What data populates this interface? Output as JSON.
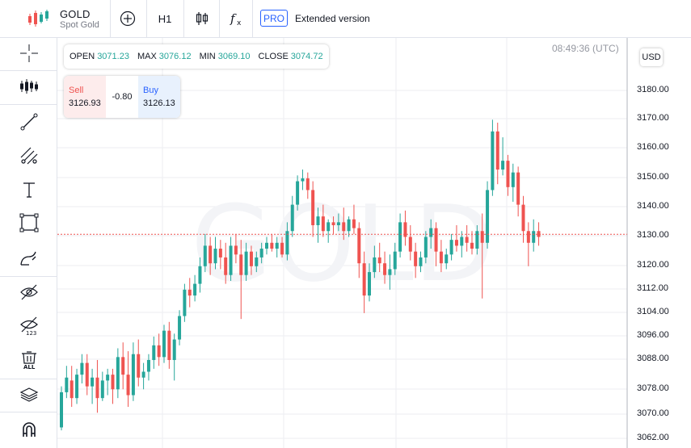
{
  "header": {
    "symbol": "GOLD",
    "subtitle": "Spot Gold",
    "timeframe": "H1",
    "pro_badge": "PRO",
    "extended_label": "Extended version"
  },
  "toolbar_icons": [
    "cursor-crosshair-icon",
    "indicators-icon",
    "trend-line-icon",
    "fib-channel-icon",
    "text-tool-icon",
    "rectangle-tool-icon",
    "brush-icon",
    "hide-drawings-icon",
    "hide-values-icon",
    "delete-all-icon",
    "layers-icon",
    "magnet-icon"
  ],
  "ohlc": {
    "open_label": "OPEN",
    "open": "3071.23",
    "max_label": "MAX",
    "max": "3076.12",
    "min_label": "MIN",
    "min": "3069.10",
    "close_label": "CLOSE",
    "close": "3074.72"
  },
  "trade": {
    "sell_label": "Sell",
    "sell_price": "3126.93",
    "spread": "-0.80",
    "buy_label": "Buy",
    "buy_price": "3126.13"
  },
  "clock": "08:49:36 (UTC)",
  "currency": "USD",
  "watermark": "GOLD",
  "colors": {
    "up": "#26a69a",
    "down": "#ef5350",
    "price_line": "#ef5350",
    "accent": "#2962ff"
  },
  "chart_data": {
    "type": "candlestick",
    "current_price": 3126.9,
    "y_tick_labels": [
      "3180.00",
      "3170.00",
      "3160.00",
      "3150.00",
      "3140.00",
      "3130.00",
      "3120.00",
      "3112.00",
      "3104.00",
      "3096.00",
      "3088.00",
      "3078.00",
      "3070.00",
      "3062.00"
    ],
    "candles": [
      [
        3061,
        3075,
        3060,
        3073
      ],
      [
        3073,
        3082,
        3071,
        3078
      ],
      [
        3077,
        3082,
        3068,
        3071
      ],
      [
        3071,
        3081,
        3069,
        3079
      ],
      [
        3079,
        3086,
        3076,
        3083
      ],
      [
        3083,
        3086,
        3072,
        3075
      ],
      [
        3075,
        3081,
        3069,
        3078
      ],
      [
        3078,
        3084,
        3066,
        3071
      ],
      [
        3071,
        3080,
        3070,
        3077
      ],
      [
        3077,
        3081,
        3072,
        3079
      ],
      [
        3079,
        3081,
        3069,
        3074
      ],
      [
        3074,
        3088,
        3071,
        3085
      ],
      [
        3085,
        3090,
        3074,
        3079
      ],
      [
        3079,
        3087,
        3068,
        3072
      ],
      [
        3072,
        3090,
        3070,
        3086
      ],
      [
        3086,
        3091,
        3075,
        3078
      ],
      [
        3078,
        3083,
        3074,
        3080
      ],
      [
        3080,
        3086,
        3077,
        3084
      ],
      [
        3084,
        3092,
        3081,
        3089
      ],
      [
        3089,
        3093,
        3082,
        3085
      ],
      [
        3085,
        3096,
        3083,
        3094
      ],
      [
        3094,
        3097,
        3081,
        3084
      ],
      [
        3084,
        3093,
        3077,
        3091
      ],
      [
        3091,
        3101,
        3089,
        3099
      ],
      [
        3099,
        3110,
        3097,
        3108
      ],
      [
        3108,
        3112,
        3102,
        3106
      ],
      [
        3106,
        3113,
        3104,
        3110
      ],
      [
        3110,
        3119,
        3107,
        3116
      ],
      [
        3116,
        3127,
        3114,
        3123
      ],
      [
        3123,
        3126,
        3113,
        3117
      ],
      [
        3117,
        3126,
        3115,
        3122
      ],
      [
        3122,
        3125,
        3115,
        3119
      ],
      [
        3119,
        3124,
        3110,
        3113
      ],
      [
        3113,
        3126,
        3111,
        3123
      ],
      [
        3123,
        3127,
        3117,
        3120
      ],
      [
        3120,
        3125,
        3098,
        3113
      ],
      [
        3113,
        3124,
        3111,
        3121
      ],
      [
        3121,
        3123,
        3113,
        3116
      ],
      [
        3116,
        3121,
        3114,
        3119
      ],
      [
        3119,
        3124,
        3117,
        3122
      ],
      [
        3122,
        3126,
        3120,
        3124
      ],
      [
        3124,
        3127,
        3121,
        3122
      ],
      [
        3122,
        3126,
        3119,
        3124
      ],
      [
        3124,
        3126,
        3119,
        3120
      ],
      [
        3120,
        3131,
        3118,
        3128
      ],
      [
        3128,
        3140,
        3126,
        3137
      ],
      [
        3137,
        3147,
        3135,
        3145
      ],
      [
        3145,
        3149,
        3142,
        3146
      ],
      [
        3146,
        3148,
        3139,
        3142
      ],
      [
        3142,
        3145,
        3126,
        3130
      ],
      [
        3130,
        3136,
        3124,
        3133
      ],
      [
        3133,
        3137,
        3126,
        3128
      ],
      [
        3128,
        3132,
        3124,
        3131
      ],
      [
        3131,
        3133,
        3127,
        3130
      ],
      [
        3130,
        3134,
        3128,
        3131
      ],
      [
        3131,
        3136,
        3125,
        3128
      ],
      [
        3128,
        3133,
        3126,
        3132
      ],
      [
        3132,
        3137,
        3127,
        3129
      ],
      [
        3129,
        3131,
        3112,
        3117
      ],
      [
        3117,
        3121,
        3100,
        3106
      ],
      [
        3106,
        3117,
        3104,
        3114
      ],
      [
        3114,
        3123,
        3112,
        3119
      ],
      [
        3119,
        3124,
        3114,
        3117
      ],
      [
        3117,
        3121,
        3110,
        3113
      ],
      [
        3113,
        3120,
        3108,
        3115
      ],
      [
        3115,
        3124,
        3113,
        3121
      ],
      [
        3121,
        3134,
        3119,
        3131
      ],
      [
        3131,
        3135,
        3123,
        3126
      ],
      [
        3126,
        3130,
        3118,
        3121
      ],
      [
        3121,
        3124,
        3112,
        3116
      ],
      [
        3116,
        3121,
        3114,
        3119
      ],
      [
        3119,
        3128,
        3117,
        3126
      ],
      [
        3126,
        3132,
        3122,
        3129
      ],
      [
        3129,
        3131,
        3116,
        3121
      ],
      [
        3121,
        3125,
        3114,
        3117
      ],
      [
        3117,
        3122,
        3115,
        3120
      ],
      [
        3120,
        3127,
        3118,
        3125
      ],
      [
        3125,
        3130,
        3121,
        3123
      ],
      [
        3123,
        3128,
        3119,
        3126
      ],
      [
        3126,
        3130,
        3121,
        3124
      ],
      [
        3124,
        3128,
        3120,
        3122
      ],
      [
        3122,
        3130,
        3120,
        3128
      ],
      [
        3128,
        3134,
        3105,
        3124
      ],
      [
        3124,
        3145,
        3122,
        3142
      ],
      [
        3142,
        3166,
        3140,
        3162
      ],
      [
        3162,
        3165,
        3144,
        3149
      ],
      [
        3149,
        3160,
        3147,
        3152
      ],
      [
        3152,
        3154,
        3140,
        3143
      ],
      [
        3143,
        3151,
        3138,
        3148
      ],
      [
        3148,
        3150,
        3133,
        3137
      ],
      [
        3137,
        3140,
        3124,
        3128
      ],
      [
        3128,
        3131,
        3116,
        3124
      ],
      [
        3124,
        3132,
        3121,
        3128
      ],
      [
        3128,
        3131,
        3123,
        3126
      ]
    ]
  }
}
